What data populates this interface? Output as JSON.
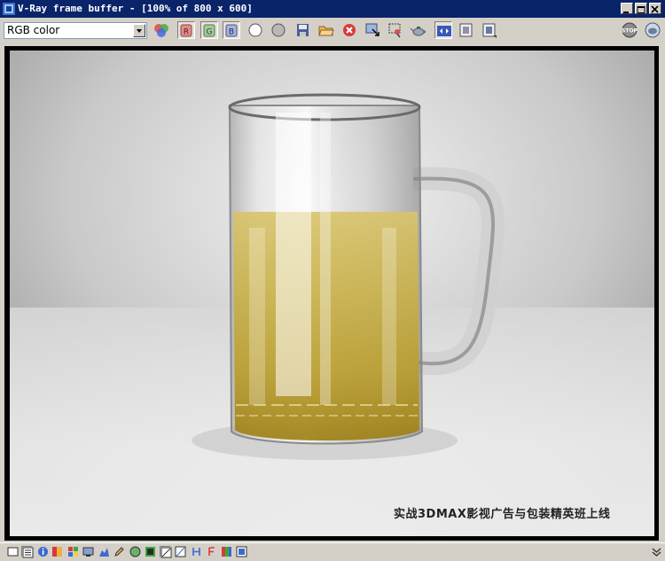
{
  "window": {
    "title": "V-Ray frame buffer - [100% of 800 x 600]"
  },
  "toolbar": {
    "channel_select": "RGB color",
    "buttons": [
      "color-picker",
      "red-channel",
      "green-channel",
      "blue-channel",
      "white-circle",
      "grey-circle",
      "save-image",
      "load-image",
      "clear-image",
      "track-mouse",
      "region-render",
      "render-last",
      "link-vfb",
      "show-corrections",
      "display-lut"
    ],
    "stop_label": "STOP"
  },
  "colors": {
    "titlebar": "#0a246a",
    "chrome": "#d4d0c8"
  },
  "render": {
    "watermark": "实战3DMAX影视广告与包装精英班上线"
  },
  "statusbar": {
    "icons": [
      "panel-icon",
      "list-icon",
      "info-icon",
      "histogram-icon",
      "pixel-icon",
      "display-icon",
      "levels-icon",
      "edit-icon",
      "sphere-icon",
      "channels-icon",
      "zoom-icon",
      "curve-icon",
      "h-icon",
      "f-icon",
      "color-swatch-icon",
      "lut-icon"
    ]
  }
}
